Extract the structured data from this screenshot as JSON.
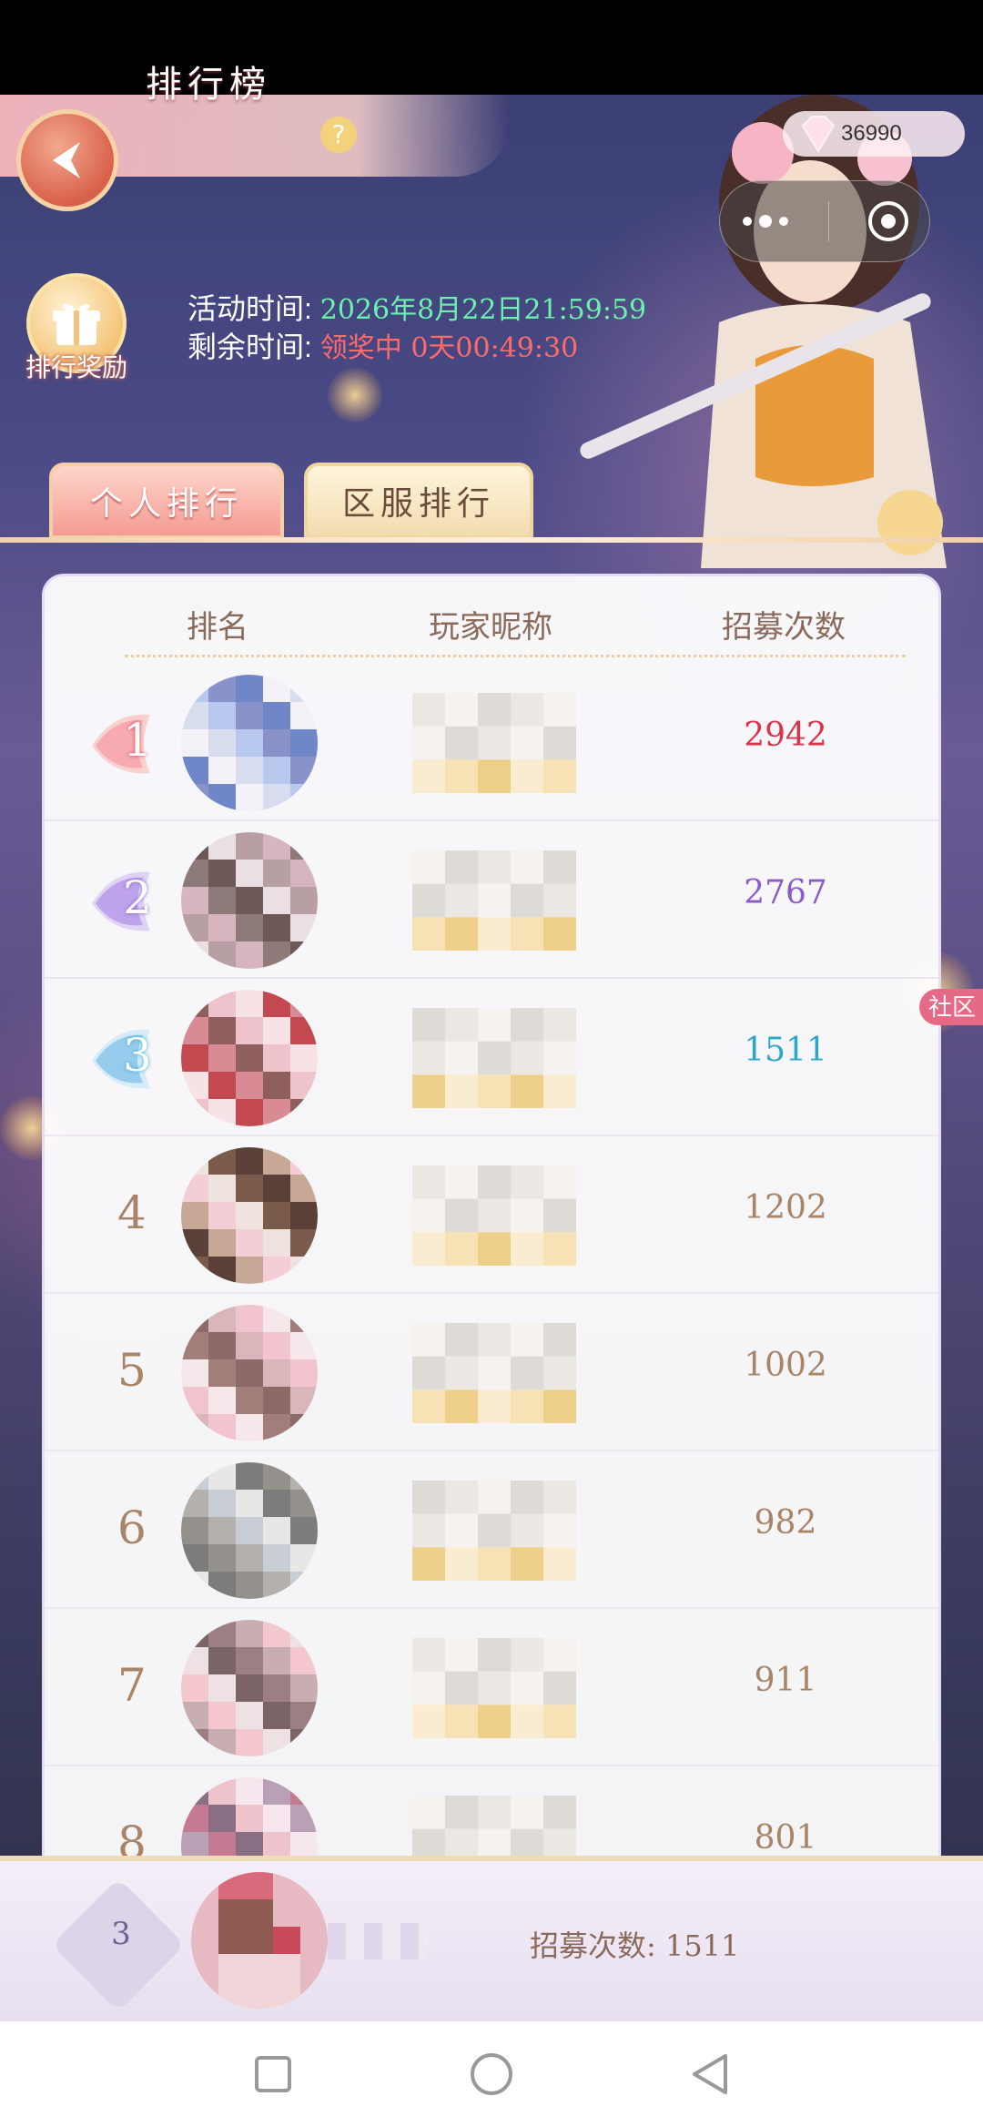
{
  "header": {
    "title": "排行榜",
    "help_symbol": "?",
    "gem_count": "36990"
  },
  "reward": {
    "label": "排行奖励"
  },
  "event": {
    "activity_label": "活动时间:",
    "activity_value": "2026年8月22日21:59:59",
    "remaining_label": "剩余时间:",
    "remaining_value": "领奖中 0天00:49:30"
  },
  "tabs": [
    {
      "label": "个人排行",
      "active": true
    },
    {
      "label": "区服排行",
      "active": false
    }
  ],
  "table": {
    "columns": [
      "排名",
      "玩家昵称",
      "招募次数"
    ],
    "rows": [
      {
        "rank": "1",
        "count": "2942",
        "color": "#d8344a"
      },
      {
        "rank": "2",
        "count": "2767",
        "color": "#8a5ac8"
      },
      {
        "rank": "3",
        "count": "1511",
        "color": "#2aa8c8"
      },
      {
        "rank": "4",
        "count": "1202",
        "color": "#a88468"
      },
      {
        "rank": "5",
        "count": "1002",
        "color": "#a88468"
      },
      {
        "rank": "6",
        "count": "982",
        "color": "#a88468"
      },
      {
        "rank": "7",
        "count": "911",
        "color": "#a88468"
      },
      {
        "rank": "8",
        "count": "801",
        "color": "#a88468"
      }
    ]
  },
  "self": {
    "rank": "3",
    "count_text": "招募次数: 1511"
  },
  "community_label": "社区",
  "icons": {
    "back": "back-arrow-icon",
    "help": "help-icon",
    "gem": "diamond-gem-icon",
    "more": "more-dots-icon",
    "close": "close-target-icon",
    "gift": "gift-box-icon",
    "nav_square": "recent-apps-icon",
    "nav_circle": "home-icon",
    "nav_triangle": "back-triangle-icon"
  }
}
